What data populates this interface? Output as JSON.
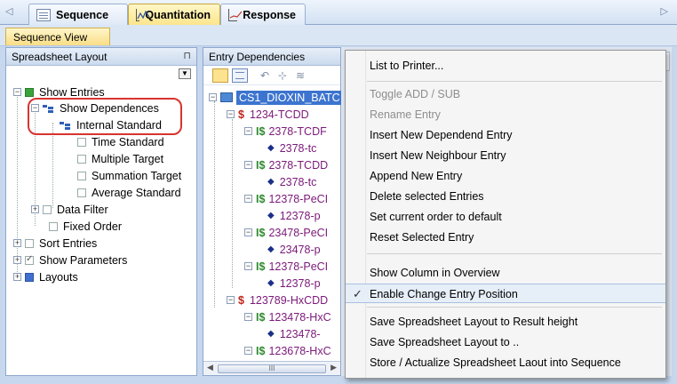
{
  "tabs": [
    {
      "label": "Sequence"
    },
    {
      "label": "Quantitation"
    },
    {
      "label": "Response"
    }
  ],
  "sequence_view_tab": "Sequence View",
  "left_panel": {
    "title": "Spreadsheet Layout",
    "tree": [
      {
        "label": "Show Entries"
      },
      {
        "label": "Show Dependences"
      },
      {
        "label": "Internal Standard"
      },
      {
        "label": "Time Standard"
      },
      {
        "label": "Multiple Target"
      },
      {
        "label": "Summation Target"
      },
      {
        "label": "Average Standard"
      },
      {
        "label": "Data Filter"
      },
      {
        "label": "Fixed Order"
      },
      {
        "label": "Sort Entries"
      },
      {
        "label": "Show Parameters"
      },
      {
        "label": "Layouts"
      }
    ]
  },
  "middle_panel": {
    "title": "Entry Dependencies",
    "scroll_thumb": "III",
    "rows": [
      {
        "prefix": "",
        "label": "CS1_DIOXIN_BATC"
      },
      {
        "prefix": "$",
        "label": "1234-TCDD"
      },
      {
        "prefix": "I$",
        "label": "2378-TCDF"
      },
      {
        "prefix": "◆",
        "label": "2378-tc"
      },
      {
        "prefix": "I$",
        "label": "2378-TCDD"
      },
      {
        "prefix": "◆",
        "label": "2378-tc"
      },
      {
        "prefix": "I$",
        "label": "12378-PeCI"
      },
      {
        "prefix": "◆",
        "label": "12378-p"
      },
      {
        "prefix": "I$",
        "label": "23478-PeCI"
      },
      {
        "prefix": "◆",
        "label": "23478-p"
      },
      {
        "prefix": "I$",
        "label": "12378-PeCI"
      },
      {
        "prefix": "◆",
        "label": "12378-p"
      },
      {
        "prefix": "$",
        "label": "123789-HxCDD"
      },
      {
        "prefix": "I$",
        "label": "123478-HxC"
      },
      {
        "prefix": "◆",
        "label": "123478-"
      },
      {
        "prefix": "I$",
        "label": "123678-HxC"
      }
    ]
  },
  "context_menu": {
    "items": [
      {
        "label": "List to Printer...",
        "enabled": true
      },
      {
        "label": "Toggle ADD / SUB",
        "enabled": false
      },
      {
        "label": "Rename Entry",
        "enabled": false
      },
      {
        "label": "Insert New Dependend Entry",
        "enabled": true
      },
      {
        "label": "Insert New Neighbour Entry",
        "enabled": true
      },
      {
        "label": "Append New Entry",
        "enabled": true
      },
      {
        "label": "Delete selected Entries",
        "enabled": true
      },
      {
        "label": "Set current order to default",
        "enabled": true
      },
      {
        "label": "Reset Selected Entry",
        "enabled": true
      },
      {
        "label": "Show Column in Overview",
        "enabled": true
      },
      {
        "label": "Enable Change Entry Position",
        "enabled": true,
        "checked": true
      },
      {
        "label": "Save Spreadsheet Layout to Result height",
        "enabled": true
      },
      {
        "label": "Save Spreadsheet Layout to ..",
        "enabled": true
      },
      {
        "label": "Store / Actualize Spreadsheet Laout into Sequence",
        "enabled": true
      }
    ],
    "check_glyph": "✓"
  },
  "colors": {
    "accent_tab": "#fbe48a",
    "selection_blue": "#3c74cf",
    "annotation_red": "#d8342f",
    "entry_purple": "#7b1979"
  }
}
